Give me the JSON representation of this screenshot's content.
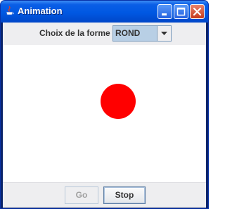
{
  "window": {
    "title": "Animation",
    "controls": [
      "minimize-icon",
      "maximize-icon",
      "close-icon"
    ]
  },
  "shape_selector": {
    "label": "Choix de la forme",
    "selected": "ROND"
  },
  "canvas": {
    "shape": "circle",
    "color": "#ff0000",
    "background": "#ffffff"
  },
  "buttons": {
    "go_label": "Go",
    "go_enabled": false,
    "stop_label": "Stop",
    "stop_enabled": true
  },
  "colors": {
    "titlebar": "#0058e2",
    "panel": "#eeeef0",
    "combo_selected": "#b8cfe5"
  }
}
